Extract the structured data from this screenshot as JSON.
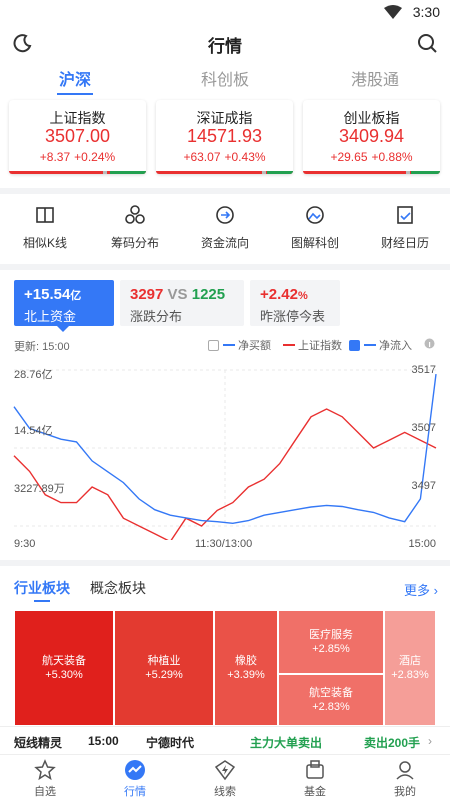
{
  "status": {
    "time": "3:30"
  },
  "header": {
    "title": "行情"
  },
  "market_tabs": [
    {
      "label": "沪深",
      "active": true
    },
    {
      "label": "科创板",
      "active": false
    },
    {
      "label": "港股通",
      "active": false
    }
  ],
  "indices": [
    {
      "name": "上证指数",
      "value": "3507.00",
      "change": "+8.37",
      "pct": "+0.24%"
    },
    {
      "name": "深证成指",
      "value": "14571.93",
      "change": "+63.07",
      "pct": "+0.43%"
    },
    {
      "name": "创业板指",
      "value": "3409.94",
      "change": "+29.65",
      "pct": "+0.88%"
    }
  ],
  "tools": [
    {
      "label": "相似K线",
      "icon": "book-icon"
    },
    {
      "label": "筹码分布",
      "icon": "chips-icon"
    },
    {
      "label": "资金流向",
      "icon": "flow-icon"
    },
    {
      "label": "图解科创",
      "icon": "image-icon"
    },
    {
      "label": "财经日历",
      "icon": "calendar-icon"
    }
  ],
  "flow_cards": {
    "north": {
      "value": "+15.54",
      "unit": "亿",
      "label": "北上资金"
    },
    "updown": {
      "up": "3297",
      "vs": "VS",
      "down": "1225",
      "label": "涨跌分布"
    },
    "limit": {
      "value": "+2.42",
      "unit": "%",
      "label": "昨涨停今表"
    }
  },
  "legend": {
    "update": "更新: 15:00",
    "net_buy": "净买额",
    "sh_index": "上证指数",
    "net_inflow": "净流入"
  },
  "chart_labels": {
    "y_top_left": "28.76亿",
    "y_mid_left": "14.54亿",
    "y_bottom_left": "3227.89万",
    "y_top_right": "3517",
    "y_mid_right": "3507",
    "y_bottom_right": "3497",
    "x_start": "9:30",
    "x_mid": "11:30/13:00",
    "x_end": "15:00"
  },
  "chart_data": {
    "type": "line",
    "x": [
      "9:30",
      "11:30/13:00",
      "15:00"
    ],
    "series": [
      {
        "name": "上证指数",
        "color": "#e93030",
        "values": [
          3506,
          3504,
          3501,
          3500,
          3500,
          3502,
          3501,
          3498,
          3497,
          3496,
          3495,
          3498,
          3497,
          3499,
          3500,
          3502,
          3503,
          3505,
          3508,
          3511,
          3512,
          3511,
          3509,
          3507,
          3508,
          3509,
          3508,
          3507
        ]
      },
      {
        "name": "净流入",
        "color": "#3478f6",
        "values": [
          22.0,
          18.0,
          17.0,
          16.0,
          15.5,
          12.0,
          10.0,
          8.0,
          5.0,
          3.0,
          2.0,
          1.5,
          1.0,
          0.8,
          0.5,
          1.0,
          2.0,
          2.5,
          3.0,
          3.5,
          3.8,
          3.6,
          3.0,
          2.5,
          1.5,
          0.8,
          5.0,
          28.0
        ]
      }
    ],
    "y_left_range": [
      0,
      28.76
    ],
    "y_right_range": [
      3497,
      3517
    ]
  },
  "sector_tabs": [
    {
      "label": "行业板块",
      "active": true
    },
    {
      "label": "概念板块",
      "active": false
    }
  ],
  "more_label": "更多",
  "sectors": [
    {
      "name": "航天装备",
      "pct": "+5.30%",
      "color": "#e0201c"
    },
    {
      "name": "种植业",
      "pct": "+5.29%",
      "color": "#e33a30"
    },
    {
      "name": "橡胶",
      "pct": "+3.39%",
      "color": "#ea5248"
    },
    {
      "name": "医疗服务",
      "pct": "+2.85%",
      "color": "#f07068"
    },
    {
      "name": "航空装备",
      "pct": "+2.83%",
      "color": "#f07068"
    },
    {
      "name": "酒店",
      "pct": "+2.83%",
      "color": "#f59e98"
    }
  ],
  "ticker": {
    "title": "短线精灵",
    "time": "15:00",
    "stock": "宁德时代",
    "event": "主力大单卖出",
    "amount": "卖出200手"
  },
  "nav": [
    {
      "label": "自选",
      "icon": "star-icon",
      "active": false
    },
    {
      "label": "行情",
      "icon": "trend-icon",
      "active": true
    },
    {
      "label": "线索",
      "icon": "lightning-icon",
      "active": false
    },
    {
      "label": "基金",
      "icon": "fund-icon",
      "active": false
    },
    {
      "label": "我的",
      "icon": "user-icon",
      "active": false
    }
  ]
}
